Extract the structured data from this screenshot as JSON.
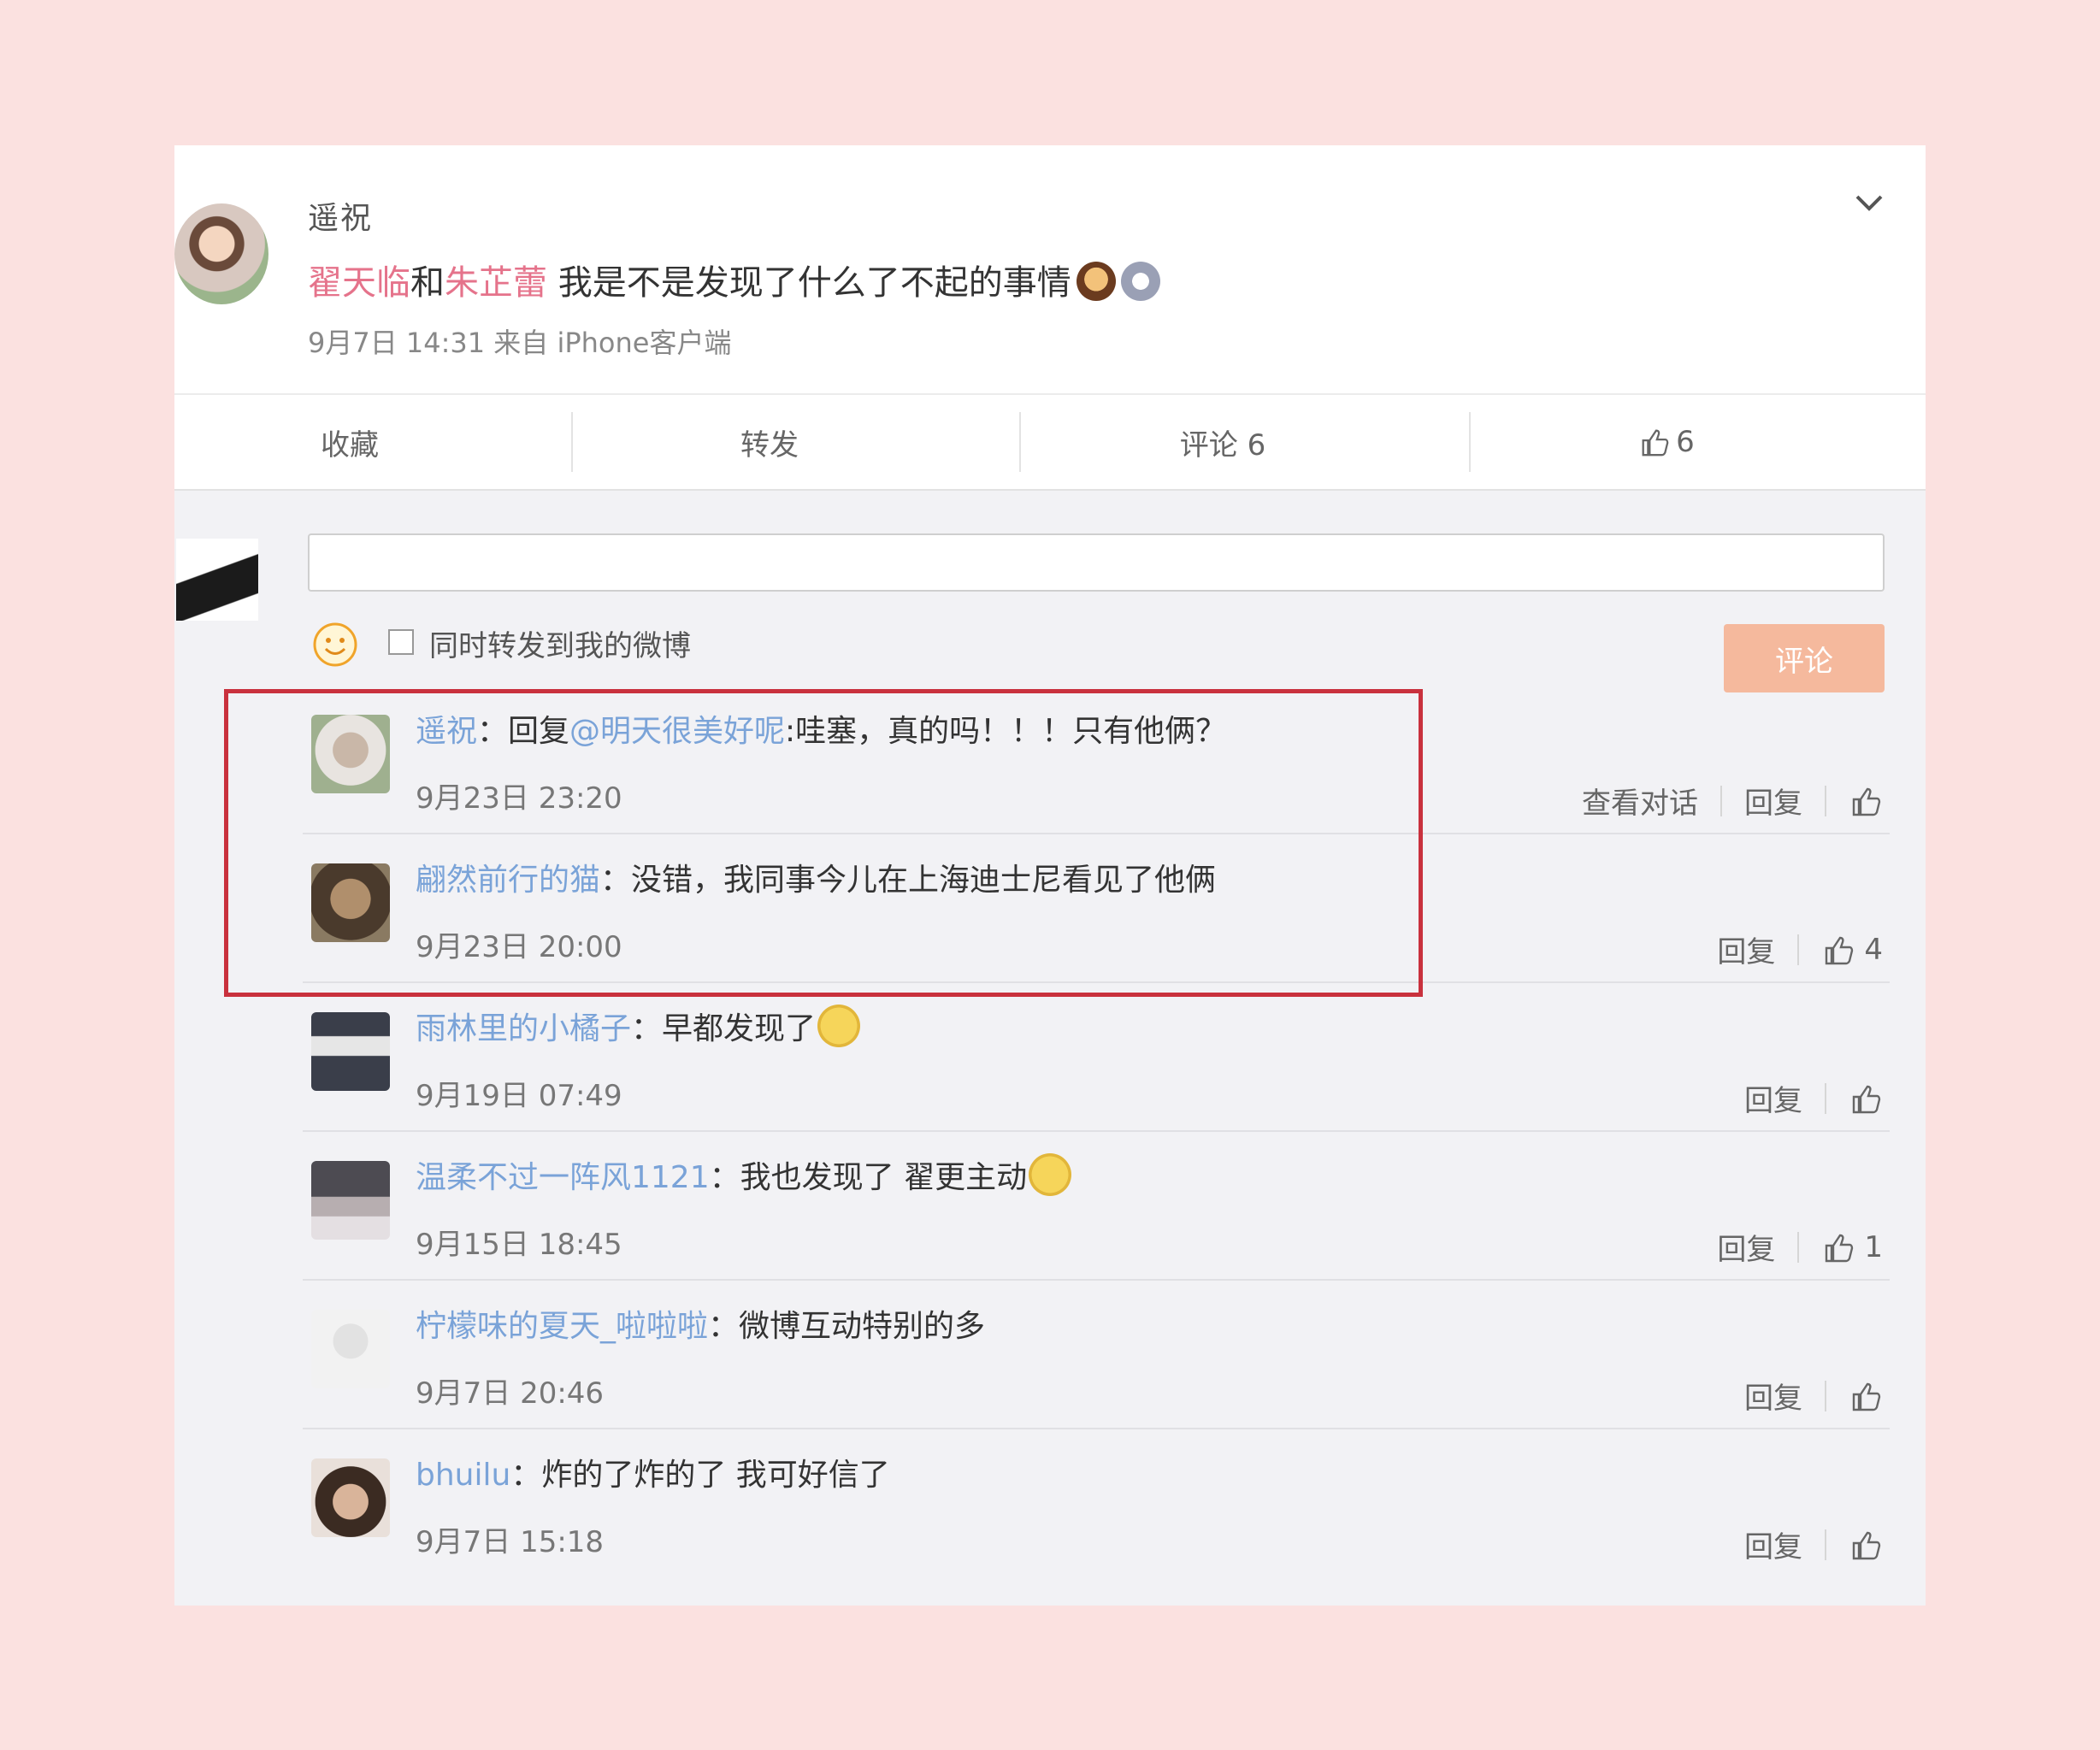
{
  "post": {
    "username": "遥祝",
    "mention_1": "翟天临",
    "connector": "和",
    "mention_2": "朱芷蕾",
    "text": "我是不是发现了什么了不起的事情",
    "meta": "9月7日 14:31 来自 iPhone客户端"
  },
  "actions": {
    "favorite": "收藏",
    "repost": "转发",
    "comment": "评论 6",
    "like_count": "6"
  },
  "composer": {
    "repost_option": "同时转发到我的微博",
    "submit": "评论"
  },
  "comments": [
    {
      "user": "遥祝",
      "prefix": "：回复",
      "mention": "@明天很美好呢",
      "text": ":哇塞，真的吗！！！只有他俩？",
      "time": "9月23日 23:20",
      "view_conversation": "查看对话",
      "reply": "回复",
      "likes": ""
    },
    {
      "user": "翩然前行的猫",
      "prefix": "",
      "mention": "",
      "text": "：没错，我同事今儿在上海迪士尼看见了他俩",
      "time": "9月23日 20:00",
      "view_conversation": "",
      "reply": "回复",
      "likes": "4"
    },
    {
      "user": "雨林里的小橘子",
      "prefix": "",
      "mention": "",
      "text": "：早都发现了",
      "time": "9月19日 07:49",
      "view_conversation": "",
      "reply": "回复",
      "likes": ""
    },
    {
      "user": "温柔不过一阵风1121",
      "prefix": "",
      "mention": "",
      "text": "：我也发现了 翟更主动",
      "time": "9月15日 18:45",
      "view_conversation": "",
      "reply": "回复",
      "likes": "1"
    },
    {
      "user": "柠檬味的夏天_啦啦啦",
      "prefix": "",
      "mention": "",
      "text": "：微博互动特别的多",
      "time": "9月7日 20:46",
      "view_conversation": "",
      "reply": "回复",
      "likes": ""
    },
    {
      "user": "bhuilu",
      "prefix": "",
      "mention": "",
      "text": "：炸的了炸的了 我可好信了",
      "time": "9月7日 15:18",
      "view_conversation": "",
      "reply": "回复",
      "likes": ""
    }
  ],
  "colors": {
    "mention": "#e5738b",
    "username": "#7aa3d8",
    "highlight_border": "#c9313d",
    "submit_bg": "#f5b99d"
  }
}
